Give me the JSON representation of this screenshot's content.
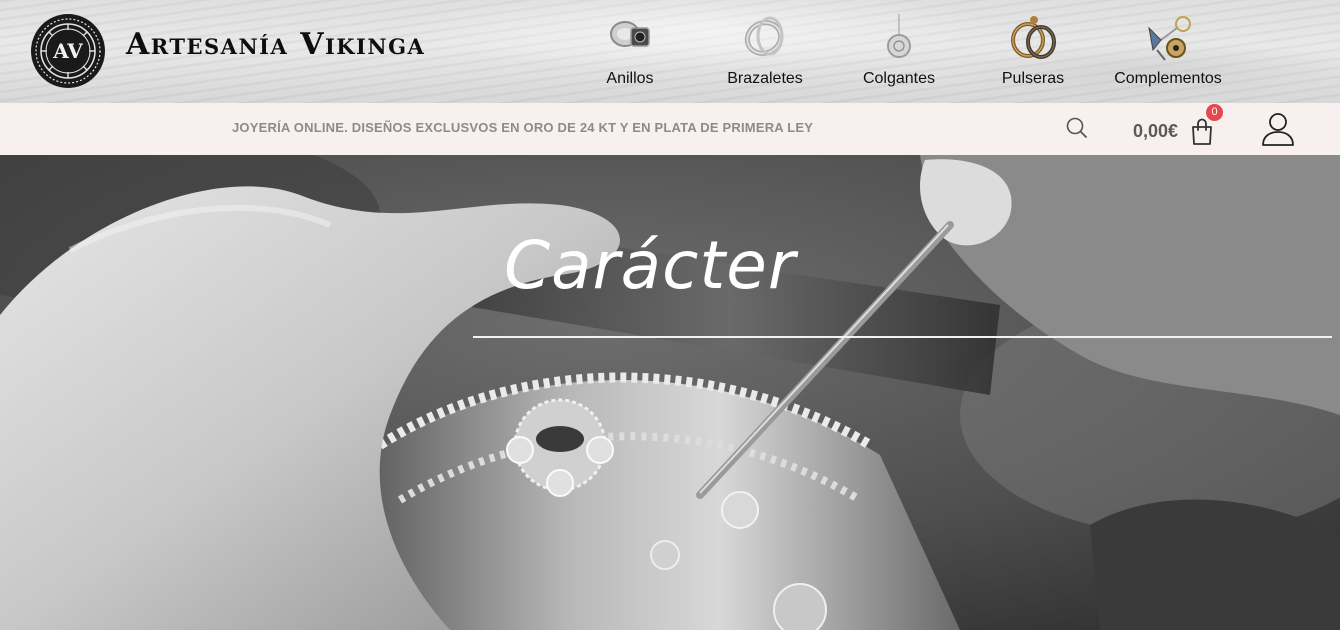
{
  "brand": {
    "name": "Artesanía Vikinga",
    "emblem_initials": "AV"
  },
  "nav": {
    "items": [
      {
        "label": "Anillos",
        "icon": "ring-icon"
      },
      {
        "label": "Brazaletes",
        "icon": "bracelet-icon"
      },
      {
        "label": "Colgantes",
        "icon": "pendant-icon"
      },
      {
        "label": "Pulseras",
        "icon": "bangle-icon"
      },
      {
        "label": "Complementos",
        "icon": "keychain-icon"
      }
    ]
  },
  "infobar": {
    "tagline": "JOYERÍA ONLINE. DISEÑOS EXCLUSVOS EN ORO DE 24 KT Y EN PLATA DE PRIMERA LEY",
    "cart_total": "0,00€",
    "cart_count": "0"
  },
  "hero": {
    "title": "Carácter"
  },
  "colors": {
    "infobar_bg": "#f8f0ee",
    "tagline": "#8f8a89",
    "cart_badge": "#e5484d",
    "hero_text": "#ffffff"
  }
}
